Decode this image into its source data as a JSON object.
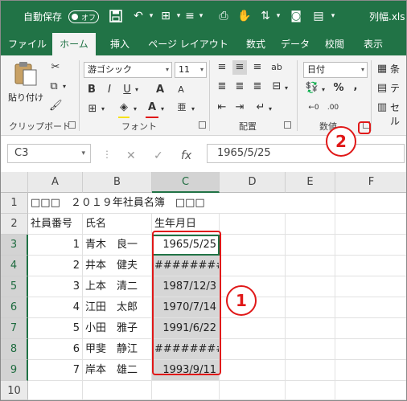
{
  "titlebar": {
    "autosave_label": "自動保存",
    "autosave_state": "オフ",
    "filename": "列幅.xls"
  },
  "tabs": [
    "ファイル",
    "ホーム",
    "挿入",
    "ページ レイアウト",
    "数式",
    "データ",
    "校閲",
    "表示"
  ],
  "active_tab": "ホーム",
  "ribbon": {
    "clipboard": {
      "paste_label": "貼り付け",
      "group_label": "クリップボード"
    },
    "font": {
      "font_name": "游ゴシック",
      "font_size": "11",
      "bold": "B",
      "italic": "I",
      "underline": "U",
      "font_color_letter": "A",
      "group_label": "フォント"
    },
    "alignment": {
      "group_label": "配置"
    },
    "number": {
      "format": "日付",
      "percent": "%",
      "comma": ",",
      "group_label": "数値"
    },
    "styles": {
      "conditional": "条",
      "table": "テ",
      "cell": "セル"
    }
  },
  "formula_bar": {
    "name_box": "C3",
    "cancel": "✕",
    "enter": "✓",
    "fx": "fx",
    "content": "1965/5/25"
  },
  "grid": {
    "columns": [
      "A",
      "B",
      "C",
      "D",
      "E",
      "F"
    ],
    "selected_column": "C",
    "rows": [
      {
        "num": "1",
        "A": "□□□　２０１９年社員名簿　□□□",
        "B": "",
        "C": ""
      },
      {
        "num": "2",
        "A": "社員番号",
        "B": "氏名",
        "C": "生年月日"
      },
      {
        "num": "3",
        "A": "1",
        "B": "青木　良一",
        "C": "1965/5/25"
      },
      {
        "num": "4",
        "A": "2",
        "B": "井本　健夫",
        "C": "########"
      },
      {
        "num": "5",
        "A": "3",
        "B": "上本　清二",
        "C": "1987/12/3"
      },
      {
        "num": "6",
        "A": "4",
        "B": "江田　太郎",
        "C": "1970/7/14"
      },
      {
        "num": "7",
        "A": "5",
        "B": "小田　雅子",
        "C": "1991/6/22"
      },
      {
        "num": "8",
        "A": "6",
        "B": "甲斐　静江",
        "C": "########"
      },
      {
        "num": "9",
        "A": "7",
        "B": "岸本　雄二",
        "C": "1993/9/11"
      },
      {
        "num": "10",
        "A": "",
        "B": "",
        "C": ""
      }
    ]
  },
  "annotations": {
    "marker1": "1",
    "marker2": "2"
  },
  "colors": {
    "excel_green": "#217346",
    "annotation_red": "#e01818"
  }
}
